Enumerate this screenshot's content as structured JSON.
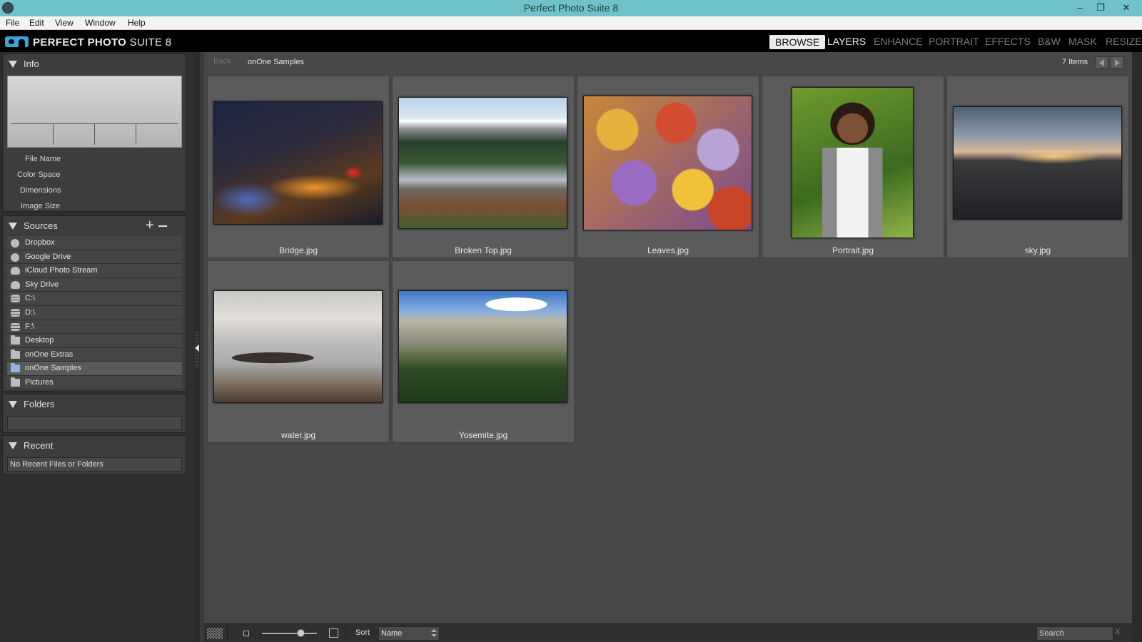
{
  "window": {
    "title": "Perfect Photo Suite 8",
    "minimize": "‒",
    "maximize": "❐",
    "close": "✕"
  },
  "menu": [
    "File",
    "Edit",
    "View",
    "Window",
    "Help"
  ],
  "brand": {
    "name_bold": "PERFECT PHOTO",
    "name_light": "SUITE 8",
    "accent": "#3ea4d8"
  },
  "modules": [
    {
      "label": "BROWSE",
      "state": "active"
    },
    {
      "label": "LAYERS",
      "state": "current"
    },
    {
      "label": "ENHANCE",
      "state": "inactive"
    },
    {
      "label": "PORTRAIT",
      "state": "inactive"
    },
    {
      "label": "EFFECTS",
      "state": "inactive"
    },
    {
      "label": "B&W",
      "state": "inactive"
    },
    {
      "label": "MASK",
      "state": "inactive"
    },
    {
      "label": "RESIZE",
      "state": "inactive"
    }
  ],
  "info": {
    "title": "Info",
    "fields": [
      "File Name",
      "Color Space",
      "Dimensions",
      "Image Size"
    ]
  },
  "sources": {
    "title": "Sources",
    "add": "+",
    "items": [
      {
        "label": "Dropbox",
        "icon": "dropbox-icon"
      },
      {
        "label": "Google Drive",
        "icon": "google-drive-icon"
      },
      {
        "label": "iCloud Photo Stream",
        "icon": "cloud-icon"
      },
      {
        "label": "Sky Drive",
        "icon": "cloud-icon"
      },
      {
        "label": "C:\\",
        "icon": "disk-icon"
      },
      {
        "label": "D:\\",
        "icon": "disk-icon"
      },
      {
        "label": "F:\\",
        "icon": "disk-icon"
      },
      {
        "label": "Desktop",
        "icon": "folder-icon"
      },
      {
        "label": "onOne Extras",
        "icon": "folder-icon"
      },
      {
        "label": "onOne Samples",
        "icon": "folder-icon",
        "selected": true
      },
      {
        "label": "Pictures",
        "icon": "folder-icon"
      }
    ]
  },
  "folders": {
    "title": "Folders"
  },
  "recent": {
    "title": "Recent",
    "empty": "No Recent Files or Folders"
  },
  "browser": {
    "back": "Back",
    "path": "onOne Samples",
    "count": "7 Items",
    "files": [
      "Bridge.jpg",
      "Broken Top.jpg",
      "Leaves.jpg",
      "Portrait.jpg",
      "sky.jpg",
      "water.jpg",
      "Yosemite.jpg"
    ]
  },
  "bottombar": {
    "thumb_size": 0.72,
    "sort_label": "Sort",
    "sort_value": "Name",
    "search_placeholder": "Search",
    "search_clear": "X"
  }
}
